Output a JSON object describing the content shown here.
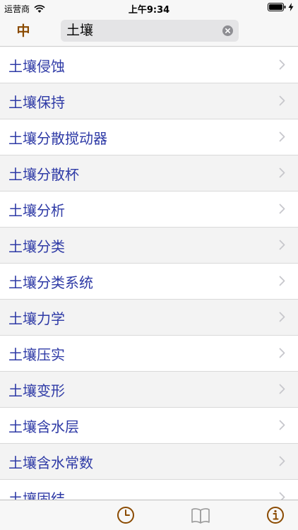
{
  "status_bar": {
    "carrier": "运营商",
    "time": "上午9:34",
    "wifi_icon": "wifi-icon",
    "battery_icon": "battery-icon",
    "charging_icon": "charging-icon"
  },
  "nav": {
    "lang_label": "中",
    "search_value": "土壤",
    "clear_icon": "clear-icon"
  },
  "colors": {
    "accent": "#8a4a00",
    "link_text": "#2e3aa6",
    "row_alt": "#f3f3f3"
  },
  "list": {
    "items": [
      {
        "label": "土壤侵蚀"
      },
      {
        "label": "土壤保持"
      },
      {
        "label": "土壤分散搅动器"
      },
      {
        "label": "土壤分散杯"
      },
      {
        "label": "土壤分析"
      },
      {
        "label": "土壤分类"
      },
      {
        "label": "土壤分类系统"
      },
      {
        "label": "土壤力学"
      },
      {
        "label": "土壤压实"
      },
      {
        "label": "土壤变形"
      },
      {
        "label": "土壤含水层"
      },
      {
        "label": "土壤含水常数"
      },
      {
        "label": "土壤固结"
      }
    ]
  },
  "tab_bar": {
    "tabs": [
      {
        "icon": "clock-icon"
      },
      {
        "icon": "book-icon"
      },
      {
        "icon": "info-icon"
      }
    ]
  }
}
